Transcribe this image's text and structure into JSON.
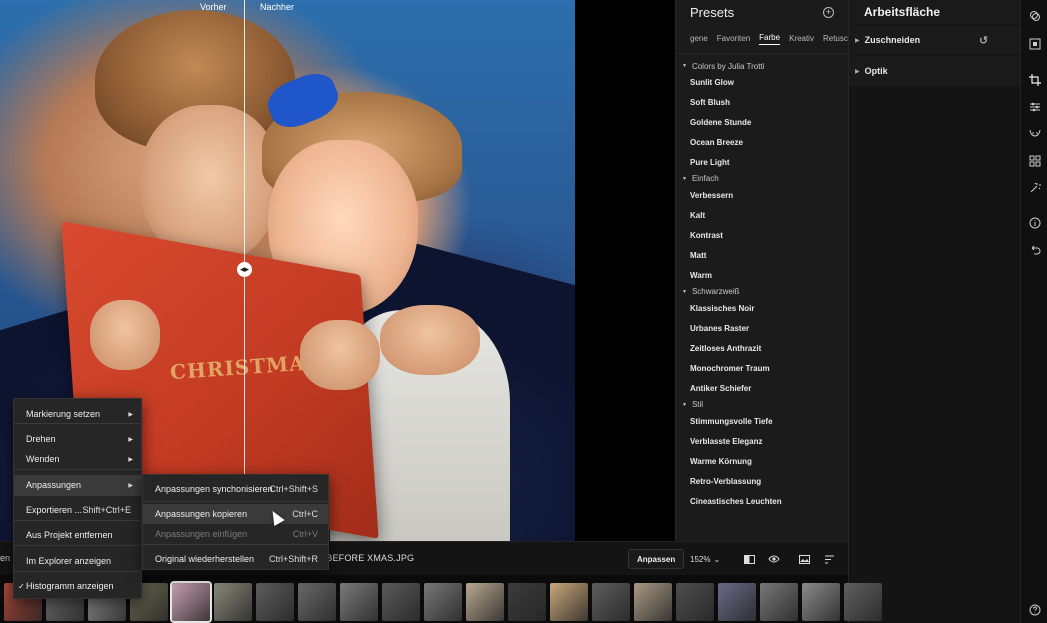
{
  "viewer": {
    "label_before": "Vorher",
    "label_after": "Nachher",
    "book_title": "CHRISTMAS",
    "split_handle_glyph": "◂▸"
  },
  "presets": {
    "title": "Presets",
    "add_icon": "+",
    "tabs": [
      "gene",
      "Favoriten",
      "Farbe",
      "Kreativ",
      "Retuschier"
    ],
    "active_tab": "Farbe",
    "groups": [
      {
        "name": "Colors by Julia Trotti",
        "items": [
          "Sunlit Glow",
          "Soft Blush",
          "Goldene Stunde",
          "Ocean Breeze",
          "Pure Light"
        ]
      },
      {
        "name": "Einfach",
        "items": [
          "Verbessern",
          "Kalt",
          "Kontrast",
          "Matt",
          "Warm"
        ]
      },
      {
        "name": "Schwarzweiß",
        "items": [
          "Klassisches Noir",
          "Urbanes Raster",
          "Zeitloses Anthrazit",
          "Monochromer Traum",
          "Antiker Schiefer"
        ]
      },
      {
        "name": "Stil",
        "items": [
          "Stimmungsvolle Tiefe",
          "Verblasste Eleganz",
          "Warme Körnung",
          "Retro-Verblassung",
          "Cineastisches Leuchten"
        ]
      }
    ]
  },
  "workspace": {
    "title": "Arbeitsfläche",
    "sections": [
      "Zuschneiden",
      "Optik"
    ],
    "reset_icon": "↺"
  },
  "toolbar": {
    "crumb": "en",
    "filename": "T BEFORE XMAS.JPG",
    "adjust_label": "Anpassen",
    "zoom": "152%",
    "zoom_caret": "⌄"
  },
  "context_menu": {
    "items": [
      {
        "label": "Markierung setzen",
        "submenu": true
      },
      {
        "label": "Drehen",
        "submenu": true
      },
      {
        "label": "Wenden",
        "submenu": true
      },
      {
        "label": "Anpassungen",
        "submenu": true,
        "highlighted": true
      },
      {
        "label": "Exportieren ...",
        "shortcut": "Shift+Ctrl+E"
      },
      {
        "label": "Aus Projekt entfernen"
      },
      {
        "label": "Im Explorer anzeigen"
      },
      {
        "label": "Histogramm anzeigen",
        "checked": true
      }
    ],
    "checkmark": "✓",
    "submenu_arrow": "▶"
  },
  "submenu": {
    "items": [
      {
        "label": "Anpassungen synchonisieren",
        "shortcut": "Ctrl+Shift+S"
      },
      {
        "label": "Anpassungen kopieren",
        "shortcut": "Ctrl+C",
        "highlighted": true
      },
      {
        "label": "Anpassungen einfügen",
        "shortcut": "Ctrl+V",
        "disabled": true
      },
      {
        "label": "Original wiederherstellen",
        "shortcut": "Ctrl+Shift+R"
      }
    ]
  },
  "icons": {
    "layers": "layers-icon",
    "crop": "crop-icon",
    "sliders": "sliders-icon",
    "face": "face-icon",
    "grid": "grid-icon",
    "magic": "magic-icon",
    "info": "info-icon",
    "undo": "undo-icon",
    "help": "help-icon"
  }
}
